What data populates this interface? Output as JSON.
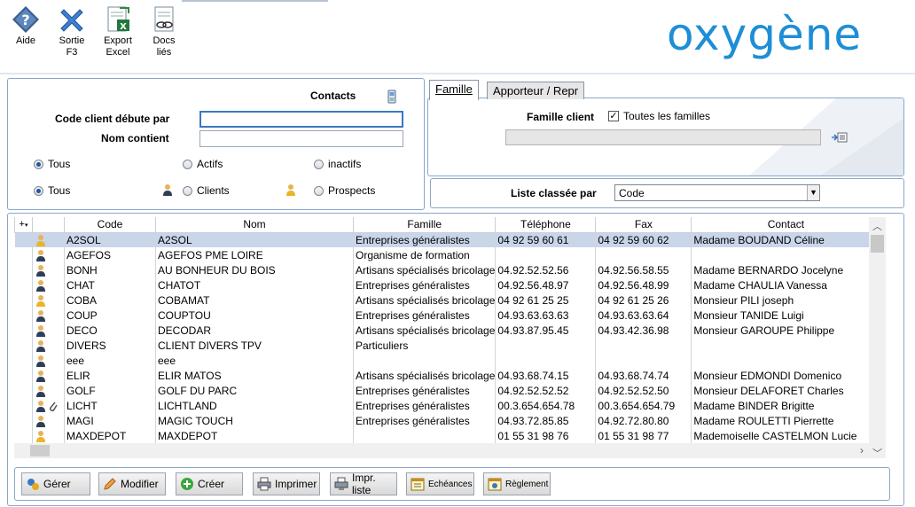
{
  "toolbar": {
    "items": [
      {
        "label": "Aide",
        "icon": "help-icon"
      },
      {
        "label": "Sortie\nF3",
        "icon": "close-icon"
      },
      {
        "label": "Export\nExcel",
        "icon": "excel-export-icon"
      },
      {
        "label": "Docs\nliés",
        "icon": "linked-docs-icon"
      }
    ]
  },
  "brand": {
    "logo_text": "oxygène",
    "color": "#1e8ed6"
  },
  "filters": {
    "contacts_label": "Contacts",
    "code_label": "Code client débute par",
    "code_value": "",
    "name_label": "Nom contient",
    "name_value": "",
    "status_radios": [
      "Tous",
      "Actifs",
      "inactifs"
    ],
    "type_radios": [
      "Tous",
      "Clients",
      "Prospects"
    ]
  },
  "family": {
    "tabs": [
      "Famille",
      "Apporteur / Repr"
    ],
    "family_label": "Famille client",
    "all_families_label": "Toutes les familles",
    "all_families_checked": true,
    "family_value": ""
  },
  "sort": {
    "label": "Liste classée par",
    "value": "Code"
  },
  "grid": {
    "columns": [
      "Code",
      "Nom",
      "Famille",
      "Téléphone",
      "Fax",
      "Contact"
    ],
    "rows": [
      {
        "code": "A2SOL",
        "nom": "A2SOL",
        "famille": "Entreprises généralistes",
        "tel": "04 92 59 60 61",
        "fax": "04 92 59 60 62",
        "contact": "Madame BOUDAND Céline",
        "type": "prospect",
        "attach": false
      },
      {
        "code": "AGEFOS",
        "nom": "AGEFOS PME LOIRE",
        "famille": "Organisme de formation",
        "tel": "",
        "fax": "",
        "contact": "",
        "type": "client",
        "attach": false
      },
      {
        "code": "BONH",
        "nom": "AU BONHEUR DU BOIS",
        "famille": "Artisans spécialisés bricolage",
        "tel": "04.92.52.52.56",
        "fax": "04.92.56.58.55",
        "contact": "Madame BERNARDO Jocelyne",
        "type": "client",
        "attach": false
      },
      {
        "code": "CHAT",
        "nom": "CHATOT",
        "famille": "Entreprises généralistes",
        "tel": "04.92.56.48.97",
        "fax": "04.92.56.48.99",
        "contact": "Madame CHAULIA Vanessa",
        "type": "client",
        "attach": false
      },
      {
        "code": "COBA",
        "nom": "COBAMAT",
        "famille": "Artisans spécialisés bricolage",
        "tel": "04 92 61 25 25",
        "fax": "04 92 61 25 26",
        "contact": "Monsieur PILI joseph",
        "type": "prospect",
        "attach": false
      },
      {
        "code": "COUP",
        "nom": "COUPTOU",
        "famille": "Entreprises généralistes",
        "tel": "04.93.63.63.63",
        "fax": "04.93.63.63.64",
        "contact": "Monsieur TANIDE Luigi",
        "type": "client",
        "attach": false
      },
      {
        "code": "DECO",
        "nom": "DECODAR",
        "famille": "Artisans spécialisés bricolage",
        "tel": "04.93.87.95.45",
        "fax": "04.93.42.36.98",
        "contact": "Monsieur GAROUPE Philippe",
        "type": "client",
        "attach": false
      },
      {
        "code": "DIVERS",
        "nom": "CLIENT DIVERS TPV",
        "famille": "Particuliers",
        "tel": "",
        "fax": "",
        "contact": "",
        "type": "client",
        "attach": false
      },
      {
        "code": "eee",
        "nom": "eee",
        "famille": "",
        "tel": "",
        "fax": "",
        "contact": "",
        "type": "client",
        "attach": false
      },
      {
        "code": "ELIR",
        "nom": "ELIR MATOS",
        "famille": "Artisans spécialisés bricolage",
        "tel": "04.93.68.74.15",
        "fax": "04.93.68.74.74",
        "contact": "Monsieur EDMONDI Domenico",
        "type": "client",
        "attach": false
      },
      {
        "code": "GOLF",
        "nom": "GOLF DU PARC",
        "famille": "Entreprises généralistes",
        "tel": "04.92.52.52.52",
        "fax": "04.92.52.52.50",
        "contact": "Monsieur DELAFORET Charles",
        "type": "client",
        "attach": false
      },
      {
        "code": "LICHT",
        "nom": "LICHTLAND",
        "famille": "Entreprises généralistes",
        "tel": "00.3.654.654.78",
        "fax": "00.3.654.654.79",
        "contact": "Madame BINDER Brigitte",
        "type": "client",
        "attach": true
      },
      {
        "code": "MAGI",
        "nom": "MAGIC TOUCH",
        "famille": "Entreprises généralistes",
        "tel": "04.93.72.85.85",
        "fax": "04.92.72.80.80",
        "contact": "Madame ROULETTI Pierrette",
        "type": "client",
        "attach": false
      },
      {
        "code": "MAXDEPOT",
        "nom": "MAXDEPOT",
        "famille": "",
        "tel": "01 55 31 98 76",
        "fax": "01 55 31 98 77",
        "contact": "Mademoiselle CASTELMON Lucie",
        "type": "prospect",
        "attach": false
      }
    ]
  },
  "actions": [
    {
      "label": "Gérer",
      "icon": "manage-icon"
    },
    {
      "label": "Modifier",
      "icon": "pencil-icon"
    },
    {
      "label": "Créer",
      "icon": "plus-icon"
    },
    {
      "label": "Imprimer",
      "icon": "printer-icon"
    },
    {
      "label": "Impr. liste",
      "icon": "print-list-icon"
    },
    {
      "label": "Echéances",
      "icon": "calendar-icon"
    },
    {
      "label": "Règlement",
      "icon": "payment-icon"
    }
  ]
}
